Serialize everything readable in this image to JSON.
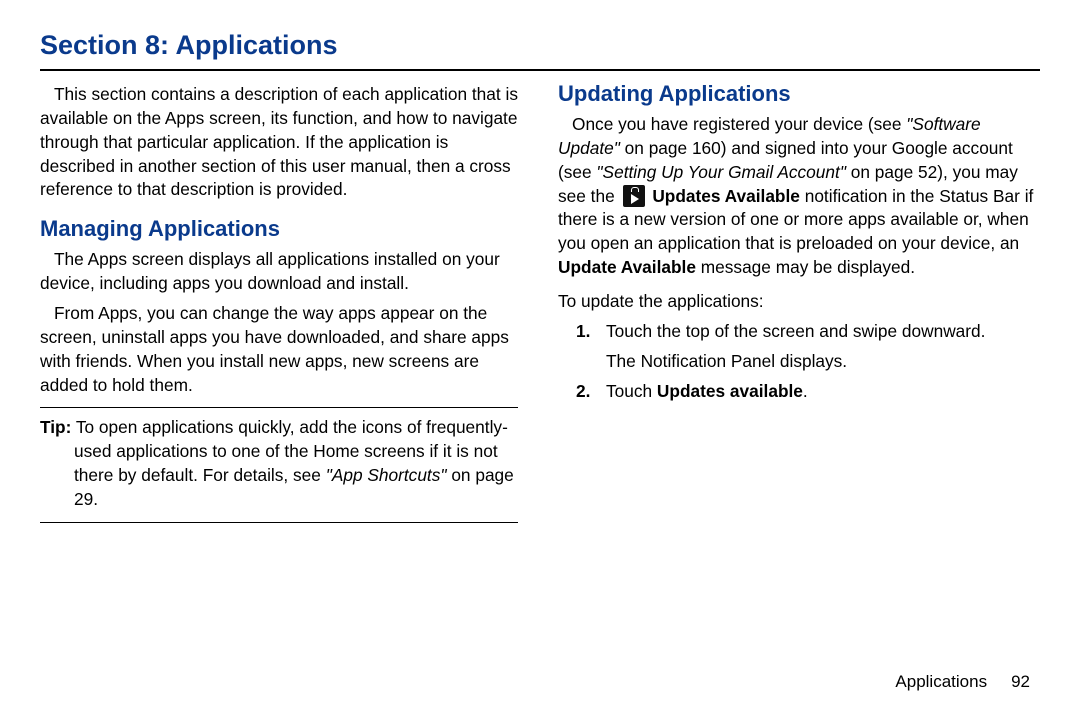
{
  "section_title": "Section 8:  Applications",
  "left": {
    "intro": "This section contains a description of each application that is available on the Apps screen, its function, and how to navigate through that particular application. If the application is described in another section of this user manual, then a cross reference to that description is provided.",
    "managing_heading": "Managing Applications",
    "managing_p1": "The Apps screen displays all applications installed on your device, including apps you download and install.",
    "managing_p2": "From Apps, you can change the way apps appear on the screen, uninstall apps you have downloaded, and share apps with friends. When you install new apps, new screens are added to hold them.",
    "tip_label": "Tip:",
    "tip_text_a": " To open applications quickly, add the icons of frequently-used applications to one of the Home screens if it is not there by default. For details, see ",
    "tip_link": "\"App Shortcuts\"",
    "tip_text_b": " on page 29."
  },
  "right": {
    "updating_heading": "Updating Applications",
    "run_a": "Once you have registered your device (see ",
    "link1": "\"Software Update\"",
    "run_b": " on page 160) and signed into your Google account (see ",
    "link2": "\"Setting Up Your Gmail Account\"",
    "run_c": " on page 52), you may see the ",
    "bold1": "Updates Available",
    "run_d": " notification in the Status Bar if there is a new version of one or more apps available or, when you open an application that is preloaded on your device, an ",
    "bold2": "Update Available",
    "run_e": " message may be displayed.",
    "lead_in": "To update the applications:",
    "step1_a": "Touch the top of the screen and swipe downward.",
    "step1_b": "The Notification Panel displays.",
    "step2_a": "Touch ",
    "step2_bold": "Updates available",
    "step2_b": "."
  },
  "footer": {
    "chapter": "Applications",
    "page": "92"
  }
}
